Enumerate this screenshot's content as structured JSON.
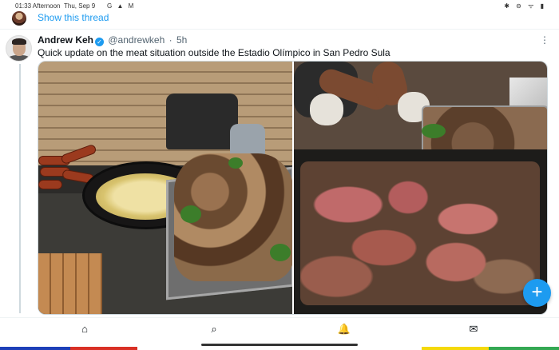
{
  "status_bar": {
    "time": "01:33 Afternoon",
    "date": "Thu, Sep 9",
    "left_icons": "G ▲ M",
    "right_icons": "✱ ⊖ ᯤ ▮"
  },
  "thread": {
    "show_thread_label": "Show this thread"
  },
  "tweet": {
    "author_name": "Andrew Keh",
    "verified_mark": "✓",
    "handle": "@andrewkeh",
    "separator": "·",
    "time_ago": "5h",
    "more_glyph": "⋮",
    "text": "Quick update on the meat situation outside the Estadio Olímpico in San Pedro Sula"
  },
  "fab": {
    "glyph": "+"
  },
  "bottom_nav": {
    "home_glyph": "⌂",
    "search_glyph": "⌕",
    "notifications_glyph": "🔔",
    "messages_glyph": "✉"
  },
  "colors": {
    "accent": "#1d9bf0",
    "edge_strip": [
      "#1d3fb8",
      "#d93025",
      "#f5d90a",
      "#34a853"
    ]
  }
}
